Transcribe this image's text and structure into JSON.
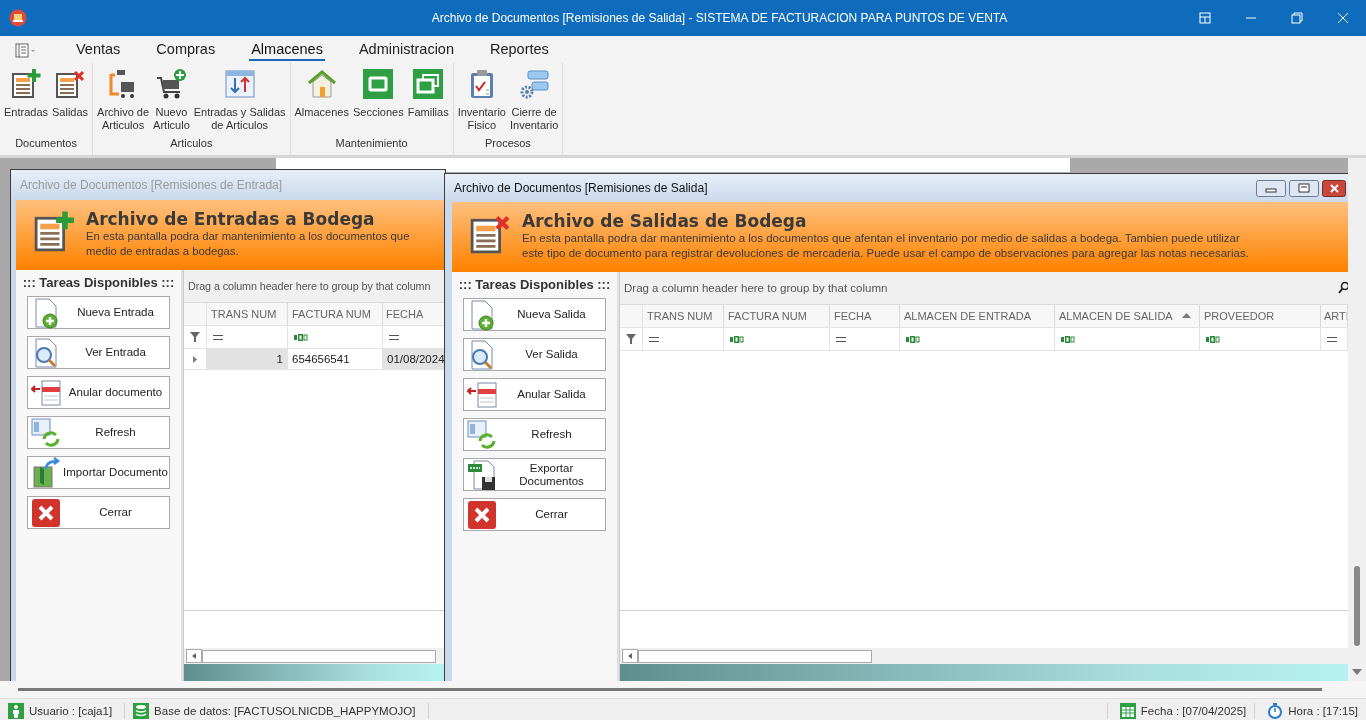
{
  "window": {
    "title": "Archivo de Documentos [Remisiones de Salida] - SISTEMA DE FACTURACION PARA PUNTOS DE VENTA"
  },
  "menu_tabs": [
    {
      "label": "Ventas",
      "selected": false
    },
    {
      "label": "Compras",
      "selected": false
    },
    {
      "label": "Almacenes",
      "selected": true
    },
    {
      "label": "Administracion",
      "selected": false
    },
    {
      "label": "Reportes",
      "selected": false
    }
  ],
  "ribbon_groups": [
    {
      "label": "Documentos",
      "buttons": [
        {
          "label": "Entradas"
        },
        {
          "label": "Salidas"
        }
      ]
    },
    {
      "label": "Articulos",
      "buttons": [
        {
          "label": "Archivo de\nArticulos"
        },
        {
          "label": "Nuevo\nArticulo"
        },
        {
          "label": "Entradas y Salidas\nde Articulos"
        }
      ]
    },
    {
      "label": "Mantenimiento",
      "buttons": [
        {
          "label": "Almacenes"
        },
        {
          "label": "Secciones"
        },
        {
          "label": "Familias"
        }
      ]
    },
    {
      "label": "Procesos",
      "buttons": [
        {
          "label": "Inventario\nFisico"
        },
        {
          "label": "Cierre de\nInventario"
        }
      ]
    }
  ],
  "documents": [
    {
      "title": "Archivo de Documentos [Remisiones de Entrada]",
      "active": false,
      "header": {
        "title": "Archivo de Entradas a Bodega",
        "description_lines": [
          "En esta pantalla podra dar mantenimiento a los documentos que",
          "medio de entradas a bodegas."
        ]
      },
      "tasks": {
        "title": "::: Tareas Disponibles :::",
        "buttons": [
          {
            "label": "Nueva Entrada"
          },
          {
            "label": "Ver Entrada"
          },
          {
            "label": "Anular documento"
          },
          {
            "label": "Refresh"
          },
          {
            "label": "Importar Documento"
          },
          {
            "label": "Cerrar"
          }
        ]
      },
      "grid": {
        "group_hint": "Drag a column header here to group by that column",
        "columns": [
          {
            "label": "TRANS NUM",
            "kind": "value",
            "sorted": false
          },
          {
            "label": "FACTURA NUM",
            "kind": "text",
            "sorted": false
          },
          {
            "label": "FECHA",
            "kind": "value",
            "sorted": false
          }
        ],
        "rows": [
          {
            "selected": true,
            "cells": [
              "1",
              "654656541",
              "01/08/2024"
            ]
          }
        ]
      }
    },
    {
      "title": "Archivo de Documentos [Remisiones de Salida]",
      "active": true,
      "header": {
        "title": "Archivo de Salidas de Bodega",
        "description_lines": [
          "En esta pantalla podra dar mantenimiento a los documentos que afentan el inventario por medio de salidas a bodega. Tambien puede utilizar",
          "este tipo de documento para registrar devoluciones de mercaderia. Puede usar el campo de observaciones para agregar las notas necesarias."
        ]
      },
      "tasks": {
        "title": "::: Tareas Disponibles :::",
        "buttons": [
          {
            "label": "Nueva Salida"
          },
          {
            "label": "Ver Salida"
          },
          {
            "label": "Anular Salida"
          },
          {
            "label": "Refresh"
          },
          {
            "label": "Exportar\nDocumentos"
          },
          {
            "label": "Cerrar"
          }
        ]
      },
      "grid": {
        "group_hint": "Drag a column header here to group by that column",
        "columns": [
          {
            "label": "TRANS NUM",
            "kind": "value",
            "sorted": false
          },
          {
            "label": "FACTURA NUM",
            "kind": "text",
            "sorted": false
          },
          {
            "label": "FECHA",
            "kind": "value",
            "sorted": false
          },
          {
            "label": "ALMACEN DE ENTRADA",
            "kind": "text",
            "sorted": false
          },
          {
            "label": "ALMACEN DE SALIDA",
            "kind": "text",
            "sorted": true
          },
          {
            "label": "PROVEEDOR",
            "kind": "text",
            "sorted": false
          },
          {
            "label": "ARTI",
            "kind": "value",
            "sorted": false
          }
        ]
      }
    }
  ],
  "status_bar": {
    "left": [
      {
        "text": "Usuario : [caja1]"
      },
      {
        "text": "Base de datos: [FACTUSOLNICDB_HAPPYMOJO]"
      }
    ],
    "right": [
      {
        "text": "Fecha : [07/04/2025]"
      },
      {
        "text": "Hora : [17:15]"
      }
    ]
  }
}
